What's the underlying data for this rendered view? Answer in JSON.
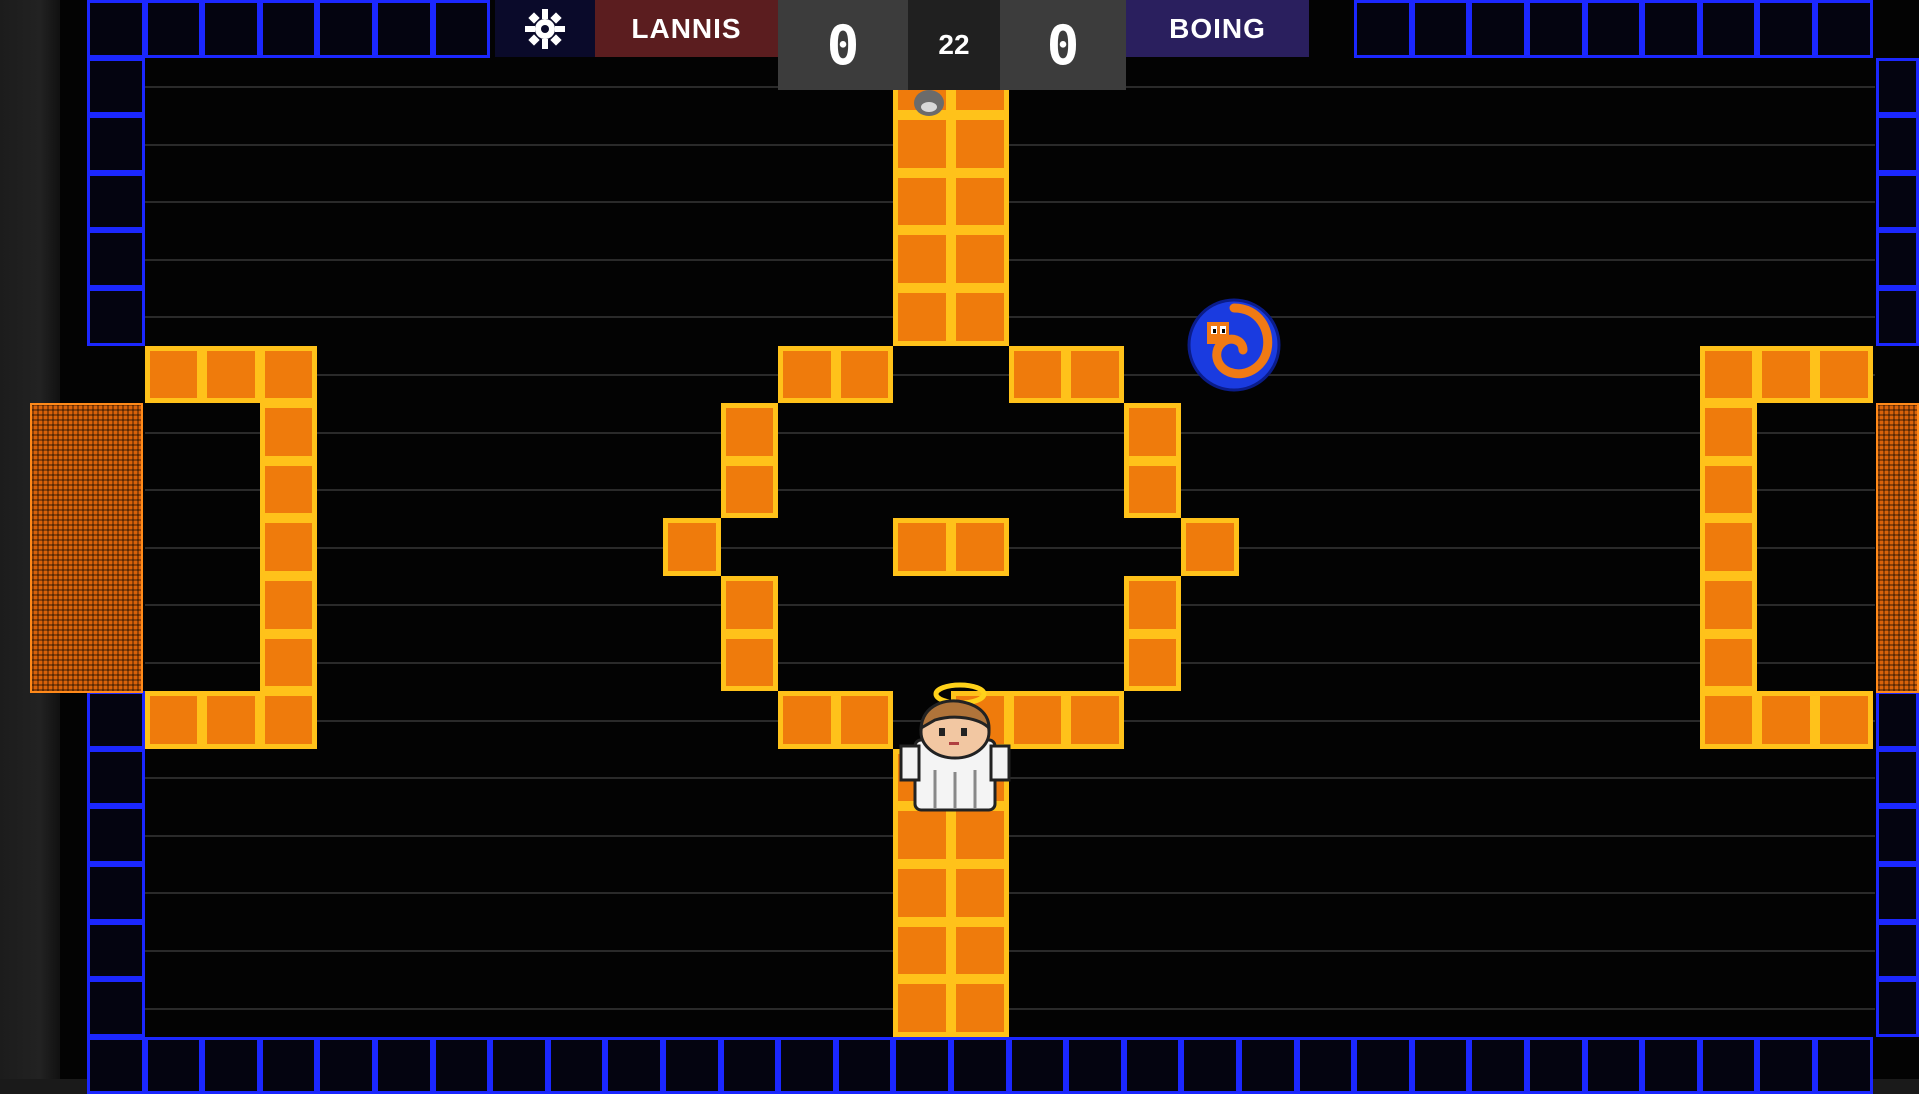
{
  "hud": {
    "team_left": "LANNIS",
    "score_left": "0",
    "timer": "22",
    "score_right": "0",
    "team_right": "BOING",
    "settings_icon": "gear-icon"
  },
  "colors": {
    "wall_blue": "#1b27ff",
    "block_orange": "#ef7b0c",
    "block_border": "#ffc21a",
    "goal_orange": "#d9620a",
    "team_left_bg": "#5b1d1f",
    "team_right_bg": "#2a1f5e"
  },
  "entities": {
    "player": "angel-player",
    "ball": "swirl-ball",
    "small_ball": "small-ball"
  }
}
